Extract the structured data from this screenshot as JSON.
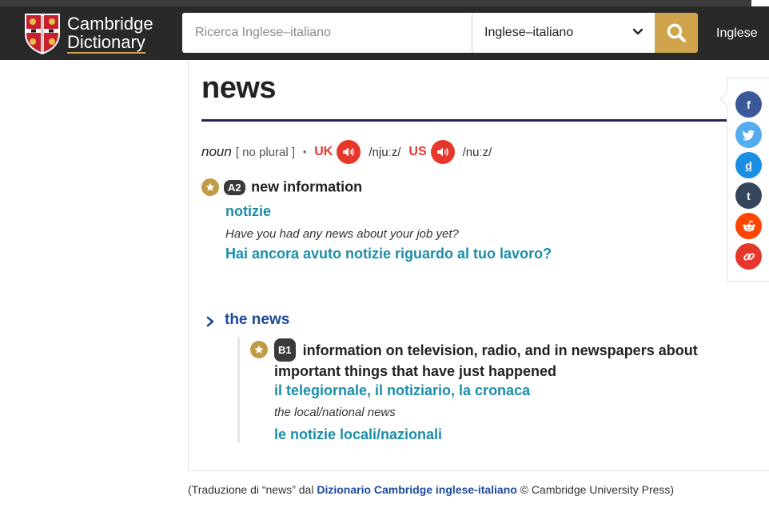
{
  "header": {
    "logo_line1": "Cambridge",
    "logo_line2": "Dictionary",
    "search_placeholder": "Ricerca Inglese–italiano",
    "search_value": "",
    "dictionary_selected": "Inglese–italiano",
    "language_link": "Inglese",
    "colors": {
      "bar": "#292929",
      "search_button": "#d0a44c"
    }
  },
  "entry": {
    "headword": "news",
    "pos": "noun",
    "grammar": "[ no plural ]",
    "separator": "•",
    "uk_label": "UK",
    "uk_ipa": "/njuːz/",
    "us_label": "US",
    "us_ipa": "/nuːz/",
    "sense1": {
      "level": "A2",
      "definition": "new information",
      "translation": "notizie",
      "example": "Have you had any news about your job yet?",
      "example_translation": "Hai ancora avuto notizie riguardo al tuo lavoro?"
    },
    "phrase": {
      "title": "the news",
      "level": "B1",
      "definition": "information on television, radio, and in newspapers about important things that have just happened",
      "translation": "il telegiornale, il notiziario, la cronaca",
      "example": "the local/national news",
      "example_translation": "le notizie locali/nazionali"
    },
    "colors": {
      "translation": "#1a8ea8",
      "phrase": "#1d4a9c",
      "pron_red": "#e5372a",
      "star": "#c09b43"
    }
  },
  "share": [
    {
      "name": "facebook",
      "glyph": "f",
      "color": "#3b5998"
    },
    {
      "name": "twitter",
      "glyph": "✉",
      "color": "#55acee"
    },
    {
      "name": "diigo",
      "glyph": "d",
      "color": "#1a8ee3"
    },
    {
      "name": "tumblr",
      "glyph": "t",
      "color": "#35465c"
    },
    {
      "name": "reddit",
      "glyph": "r",
      "color": "#ff4500"
    },
    {
      "name": "link",
      "glyph": "∞",
      "color": "#e5372a"
    }
  ],
  "footer": {
    "prefix": "(Traduzione di “news” dal",
    "dictionary": "Dizionario Cambridge inglese-italiano",
    "suffix": "© Cambridge University Press)"
  }
}
